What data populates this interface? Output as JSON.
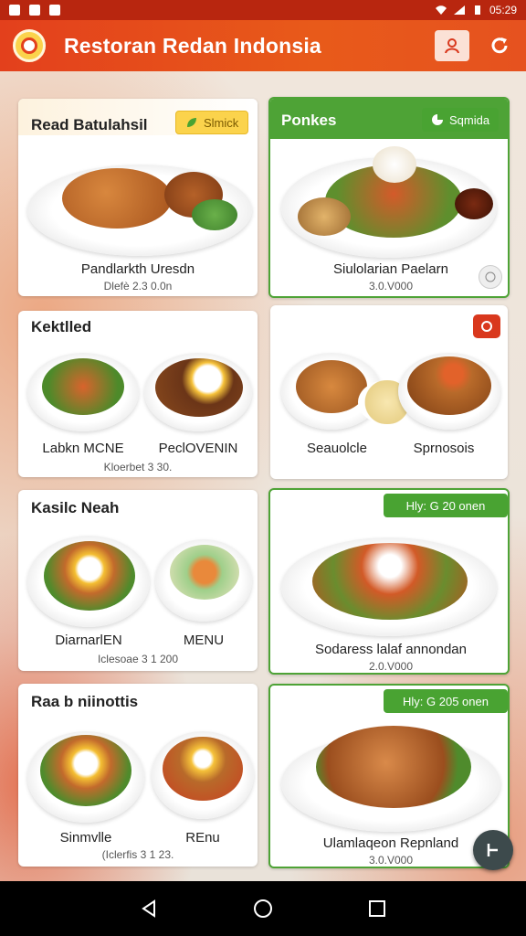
{
  "status_bar": {
    "time": "05:29",
    "icons": [
      "notification-icon",
      "notification-icon",
      "notification-icon"
    ]
  },
  "app_bar": {
    "title": "Restoran Redan Indonsia"
  },
  "cards": [
    {
      "title": "Read Batulahsil",
      "badge": "Slmick",
      "dishes": [
        {
          "name": "Pandlarkth Uresdn",
          "price": "Dlefè 2.3 0.0n"
        }
      ]
    },
    {
      "title": "Ponkes",
      "badge": "Sqmida",
      "dishes": [
        {
          "name": "Siulolarian Paelarn",
          "price": "3.0.V000"
        }
      ]
    },
    {
      "title": "Kektlled",
      "badge": "",
      "dishes": [
        {
          "name": "Labkn MCNE",
          "price": ""
        },
        {
          "name": "PeclOVENIN",
          "price": ""
        }
      ],
      "footer_price": "Kloerbet 3 30."
    },
    {
      "title": "",
      "badge": "",
      "dishes": [
        {
          "name": "Seauolcle",
          "price": ""
        },
        {
          "name": "Sprnosois",
          "price": ""
        }
      ]
    },
    {
      "title": "Kasilc Neah",
      "badge": "",
      "dishes": [
        {
          "name": "DiarnarlEN",
          "price": ""
        },
        {
          "name": "MENU",
          "price": ""
        }
      ],
      "footer_price": "Iclesoae 3 1 200"
    },
    {
      "title": "",
      "badge": "Hly: G  20 onen",
      "dishes": [
        {
          "name": "Sodaress lalaf annondan",
          "price": "2.0.V000"
        }
      ]
    },
    {
      "title": "Raa b niinottis",
      "badge": "",
      "dishes": [
        {
          "name": "Sinmvlle",
          "price": ""
        },
        {
          "name": "REnu",
          "price": ""
        }
      ],
      "footer_price": "(Iclerfis 3 1 23."
    },
    {
      "title": "",
      "badge": "Hly: G  205 onen",
      "dishes": [
        {
          "name": "Ulamlaqeon Repnland",
          "price": "3.0.V000"
        }
      ]
    }
  ],
  "colors": {
    "accent": "#e3401c",
    "green": "#4ea336",
    "yellow": "#fbd34c"
  }
}
